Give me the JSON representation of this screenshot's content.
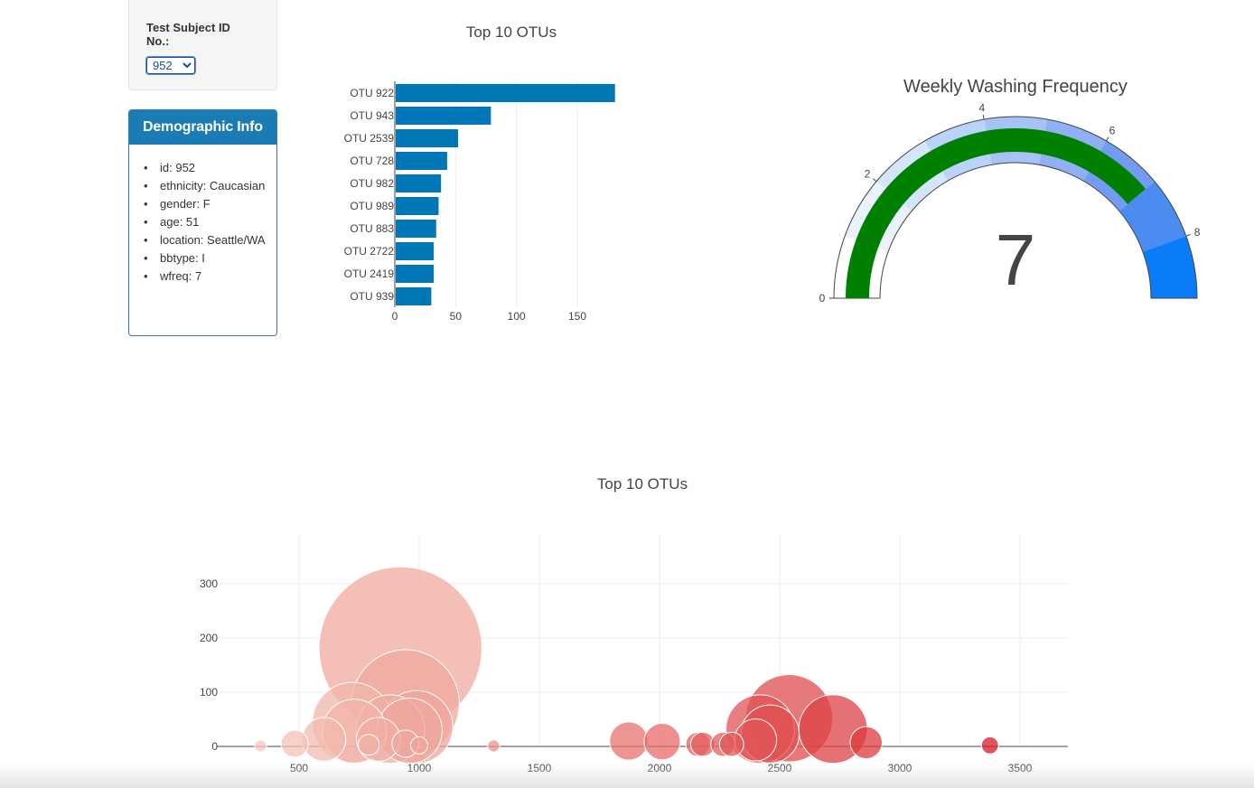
{
  "selector": {
    "label": "Test Subject ID No.:",
    "selected_value": "952"
  },
  "demographic": {
    "title": "Demographic Info",
    "items": [
      "id: 952",
      "ethnicity: Caucasian",
      "gender: F",
      "age: 51",
      "location: Seattle/WA",
      "bbtype: I",
      "wfreq: 7"
    ]
  },
  "colors": {
    "panel_heading": "#1b7bb4",
    "bar": "#0077b6",
    "gauge_bar": "#008000"
  },
  "chart_data": [
    {
      "type": "bar",
      "orientation": "horizontal",
      "title": "Top 10 OTUs",
      "categories": [
        "OTU 922",
        "OTU 943",
        "OTU 2539",
        "OTU 728",
        "OTU 982",
        "OTU 989",
        "OTU 883",
        "OTU 2722",
        "OTU 2419",
        "OTU 939"
      ],
      "values": [
        181,
        79,
        52,
        43,
        38,
        36,
        34,
        32,
        32,
        30
      ],
      "xticks": [
        0,
        50,
        100,
        150
      ],
      "xlim": [
        0,
        190
      ],
      "grid": true
    },
    {
      "type": "gauge",
      "title": "Weekly Washing Frequency",
      "value": 7,
      "range": [
        0,
        9
      ],
      "ticks": [
        0,
        2,
        4,
        6,
        8
      ],
      "steps": [
        {
          "range": [
            0,
            1
          ],
          "color": "#ffffff"
        },
        {
          "range": [
            1,
            2
          ],
          "color": "#eaf3fd"
        },
        {
          "range": [
            2,
            3
          ],
          "color": "#d3e6fb"
        },
        {
          "range": [
            3,
            4
          ],
          "color": "#b9d3fa"
        },
        {
          "range": [
            4,
            5
          ],
          "color": "#a6c2f7"
        },
        {
          "range": [
            5,
            6
          ],
          "color": "#8fb0f5"
        },
        {
          "range": [
            6,
            7
          ],
          "color": "#729cf3"
        },
        {
          "range": [
            7,
            8
          ],
          "color": "#4a8cf0"
        },
        {
          "range": [
            8,
            9
          ],
          "color": "#0a7cf7"
        }
      ]
    },
    {
      "type": "scatter",
      "subtype": "bubble",
      "title": "Top 10 OTUs",
      "xticks": [
        500,
        1000,
        1500,
        2000,
        2500,
        3000,
        3500
      ],
      "yticks": [
        0,
        100,
        200,
        300
      ],
      "xlim": [
        170,
        3700
      ],
      "ylim": [
        -5,
        390
      ],
      "grid": true,
      "points": [
        {
          "x": 340,
          "y": 1
        },
        {
          "x": 482,
          "y": 5
        },
        {
          "x": 604,
          "y": 13
        },
        {
          "x": 722,
          "y": 44
        },
        {
          "x": 730,
          "y": 28
        },
        {
          "x": 790,
          "y": 3
        },
        {
          "x": 830,
          "y": 13
        },
        {
          "x": 880,
          "y": 32
        },
        {
          "x": 922,
          "y": 181
        },
        {
          "x": 943,
          "y": 79
        },
        {
          "x": 943,
          "y": 5
        },
        {
          "x": 960,
          "y": 29
        },
        {
          "x": 989,
          "y": 36
        },
        {
          "x": 1000,
          "y": 2
        },
        {
          "x": 1310,
          "y": 1
        },
        {
          "x": 1872,
          "y": 10
        },
        {
          "x": 2011,
          "y": 9
        },
        {
          "x": 2160,
          "y": 4
        },
        {
          "x": 2180,
          "y": 4
        },
        {
          "x": 2264,
          "y": 4
        },
        {
          "x": 2300,
          "y": 4
        },
        {
          "x": 2400,
          "y": 12
        },
        {
          "x": 2419,
          "y": 32
        },
        {
          "x": 2460,
          "y": 23
        },
        {
          "x": 2539,
          "y": 52
        },
        {
          "x": 2722,
          "y": 32
        },
        {
          "x": 2860,
          "y": 7
        },
        {
          "x": 3375,
          "y": 2
        }
      ]
    }
  ]
}
